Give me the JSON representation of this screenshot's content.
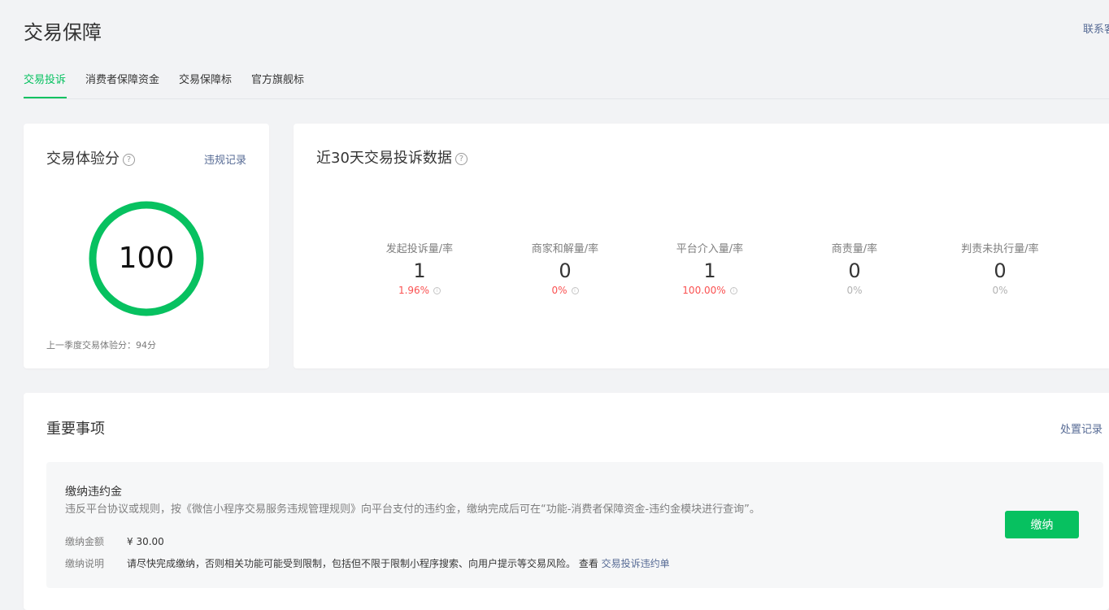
{
  "header": {
    "title": "交易保障",
    "contact_link": "联系客服"
  },
  "tabs": [
    {
      "label": "交易投诉",
      "active": true
    },
    {
      "label": "消费者保障资金",
      "active": false
    },
    {
      "label": "交易保障标",
      "active": false
    },
    {
      "label": "官方旗舰标",
      "active": false
    }
  ],
  "score_card": {
    "title": "交易体验分",
    "help_icon": "?",
    "violation_link": "违规记录",
    "score": "100",
    "last_quarter": "上一季度交易体验分：94分",
    "ring_color": "#07c160"
  },
  "stats_card": {
    "title": "近30天交易投诉数据",
    "help_icon": "?",
    "stats": [
      {
        "label": "发起投诉量/率",
        "value": "1",
        "rate": "1.96%",
        "rate_color": "red",
        "has_info": true
      },
      {
        "label": "商家和解量/率",
        "value": "0",
        "rate": "0%",
        "rate_color": "red",
        "has_info": true
      },
      {
        "label": "平台介入量/率",
        "value": "1",
        "rate": "100.00%",
        "rate_color": "red",
        "has_info": true
      },
      {
        "label": "商责量/率",
        "value": "0",
        "rate": "0%",
        "rate_color": "gray",
        "has_info": false
      },
      {
        "label": "判责未执行量/率",
        "value": "0",
        "rate": "0%",
        "rate_color": "gray",
        "has_info": false
      }
    ]
  },
  "important": {
    "title": "重要事项",
    "records_link": "处置记录",
    "item": {
      "title": "缴纳违约金",
      "description": "违反平台协议或规则，按《微信小程序交易服务违规管理规则》向平台支付的违约金，缴纳完成后可在“功能-消费者保障资金-违约金模块进行查询”。",
      "amount_label": "缴纳金额",
      "amount_value": "¥ 30.00",
      "note_label": "缴纳说明",
      "note_value": "请尽快完成缴纳，否则相关功能可能受到限制，包括但不限于限制小程序搜索、向用户提示等交易风险。 查看",
      "note_link": "交易投诉违约单",
      "pay_button": "缴纳"
    }
  },
  "colors": {
    "accent": "#07c160",
    "link": "#576b95",
    "danger": "#fa5151"
  }
}
